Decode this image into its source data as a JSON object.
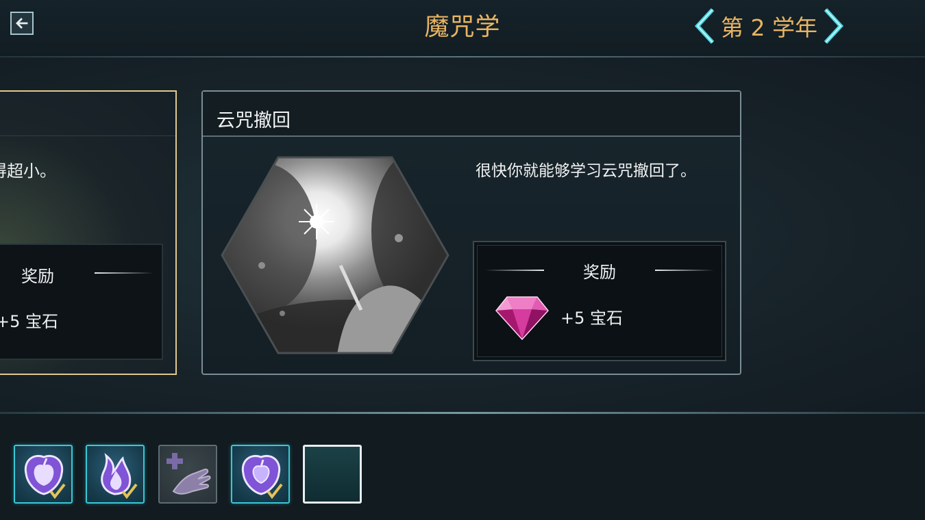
{
  "header": {
    "back_icon": "arrow-left-icon",
    "title": "魔咒学",
    "year_label": "第 2 学年",
    "prev_icon": "chevron-left-icon",
    "next_icon": "chevron-right-icon",
    "accent_color": "#e9b462"
  },
  "previous_card": {
    "description": "变得超小。",
    "reward_label": "奖励",
    "reward_text": "+5 宝石"
  },
  "lesson_card": {
    "title": "云咒撤回",
    "illustration": "wand-cloud-illustration",
    "description": "很快你就能够学习云咒撤回了。",
    "reward_label": "奖励",
    "reward_icon": "gem-icon",
    "reward_text": "+5 宝石"
  },
  "lesson_slots": [
    {
      "icon": "apple-shield-icon",
      "state": "completed"
    },
    {
      "icon": "flame-icon",
      "state": "completed"
    },
    {
      "icon": "healing-hand-icon",
      "state": "locked"
    },
    {
      "icon": "apple-shield-icon",
      "state": "completed"
    },
    {
      "icon": "",
      "state": "selected-empty"
    }
  ]
}
